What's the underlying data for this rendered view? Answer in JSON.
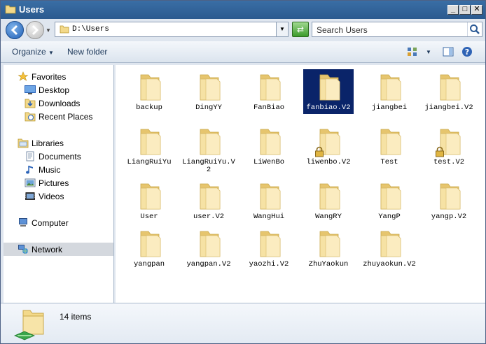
{
  "window": {
    "title": "Users"
  },
  "address": {
    "path": "D:\\Users"
  },
  "search": {
    "placeholder": "Search Users"
  },
  "toolbar": {
    "organize_label": "Organize",
    "new_folder_label": "New folder"
  },
  "nav": {
    "favorites": "Favorites",
    "desktop": "Desktop",
    "downloads": "Downloads",
    "recent_places": "Recent Places",
    "libraries": "Libraries",
    "documents": "Documents",
    "music": "Music",
    "pictures": "Pictures",
    "videos": "Videos",
    "computer": "Computer",
    "network": "Network"
  },
  "files": [
    {
      "name": "backup"
    },
    {
      "name": "DingYY"
    },
    {
      "name": "FanBiao"
    },
    {
      "name": "fanbiao.V2"
    },
    {
      "name": "jiangbei"
    },
    {
      "name": "jiangbei.V2"
    },
    {
      "name": "LiangRuiYu"
    },
    {
      "name": "LiangRuiYu.V2"
    },
    {
      "name": "LiWenBo"
    },
    {
      "name": "liwenbo.V2"
    },
    {
      "name": "Test"
    },
    {
      "name": "test.V2"
    },
    {
      "name": "User"
    },
    {
      "name": "user.V2"
    },
    {
      "name": "WangHui"
    },
    {
      "name": "WangRY"
    },
    {
      "name": "YangP"
    },
    {
      "name": "yangp.V2"
    },
    {
      "name": "yangpan"
    },
    {
      "name": "yangpan.V2"
    },
    {
      "name": "yaozhi.V2"
    },
    {
      "name": "ZhuYaokun"
    },
    {
      "name": "zhuyaokun.V2"
    }
  ],
  "status": {
    "item_count": "14 items"
  },
  "colors": {
    "selection": "#0a2469",
    "folder": "#f3d98a"
  }
}
